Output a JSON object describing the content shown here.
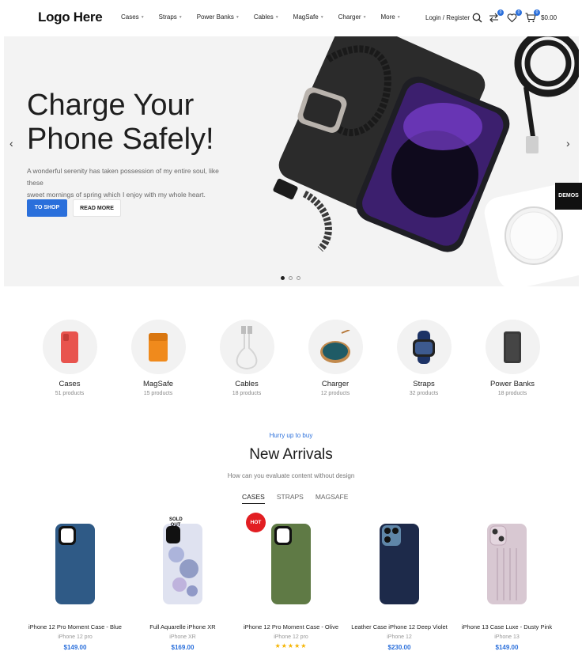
{
  "header": {
    "logo": "Logo Here",
    "nav": [
      "Cases",
      "Straps",
      "Power Banks",
      "Cables",
      "MagSafe",
      "Charger",
      "More"
    ],
    "login": "Login / Register",
    "compare_count": "0",
    "wishlist_count": "0",
    "cart_count": "0",
    "cart_total": "$0.00"
  },
  "hero": {
    "title_line1": "Charge Your",
    "title_line2": "Phone Safely!",
    "description_line1": "A wonderful serenity has taken possession of my entire soul, like these",
    "description_line2": "sweet mornings of spring which I enjoy with my whole heart.",
    "primary_button": "TO SHOP",
    "secondary_button": "READ MORE",
    "slide_count": 3,
    "active_slide": 1,
    "demos_label": "DEMOS"
  },
  "categories": [
    {
      "name": "Cases",
      "count": "51 products"
    },
    {
      "name": "MagSafe",
      "count": "15 products"
    },
    {
      "name": "Cables",
      "count": "18 products"
    },
    {
      "name": "Charger",
      "count": "12 products"
    },
    {
      "name": "Straps",
      "count": "32 products"
    },
    {
      "name": "Power Banks",
      "count": "18 products"
    }
  ],
  "section": {
    "eyebrow": "Hurry up to buy",
    "title": "New Arrivals",
    "subtitle": "How can you evaluate content without design",
    "tabs": [
      "CASES",
      "STRAPS",
      "MAGSAFE"
    ]
  },
  "products": [
    {
      "name": "iPhone 12 Pro Moment Case - Blue",
      "model": "iPhone 12 pro",
      "price": "$149.00",
      "color": "#2f5a86"
    },
    {
      "name": "Full Aquarelle iPhone XR",
      "model": "iPhone XR",
      "price": "$169.00",
      "badge_line1": "SOLD",
      "badge_line2": "OUT"
    },
    {
      "name": "iPhone 12 Pro Moment Case - Olive",
      "model": "iPhone 12 pro",
      "price": "",
      "badge": "HOT",
      "stars": "★★★★★",
      "color": "#5f7a45"
    },
    {
      "name": "Leather Case iPhone 12 Deep Violet",
      "model": "iPhone 12",
      "price": "$230.00",
      "color": "#1d2a4a"
    },
    {
      "name": "iPhone 13 Case Luxe - Dusty Pink",
      "model": "iPhone 13",
      "price": "$149.00",
      "color": "#d8c8d2"
    }
  ],
  "colors": {
    "accent": "#2a6fdb",
    "hot_badge": "#e21e22",
    "hero_bg": "#f3f3f3"
  }
}
